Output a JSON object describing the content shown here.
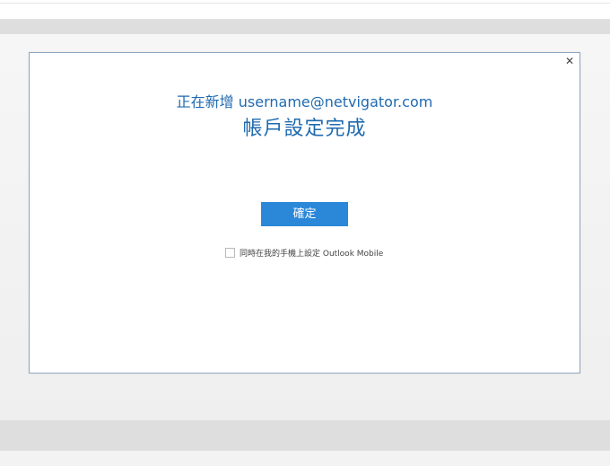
{
  "dialog": {
    "close_glyph": "✕",
    "subtitle": "正在新增 username@netvigator.com",
    "title": "帳戶設定完成",
    "ok_label": "確定",
    "mobile_checkbox": {
      "label": "同時在我的手機上設定 Outlook Mobile",
      "checked": false
    }
  },
  "colors": {
    "accent": "#2b88d8",
    "title_text": "#1f6ab0",
    "dialog_border": "#8fa7c2"
  }
}
